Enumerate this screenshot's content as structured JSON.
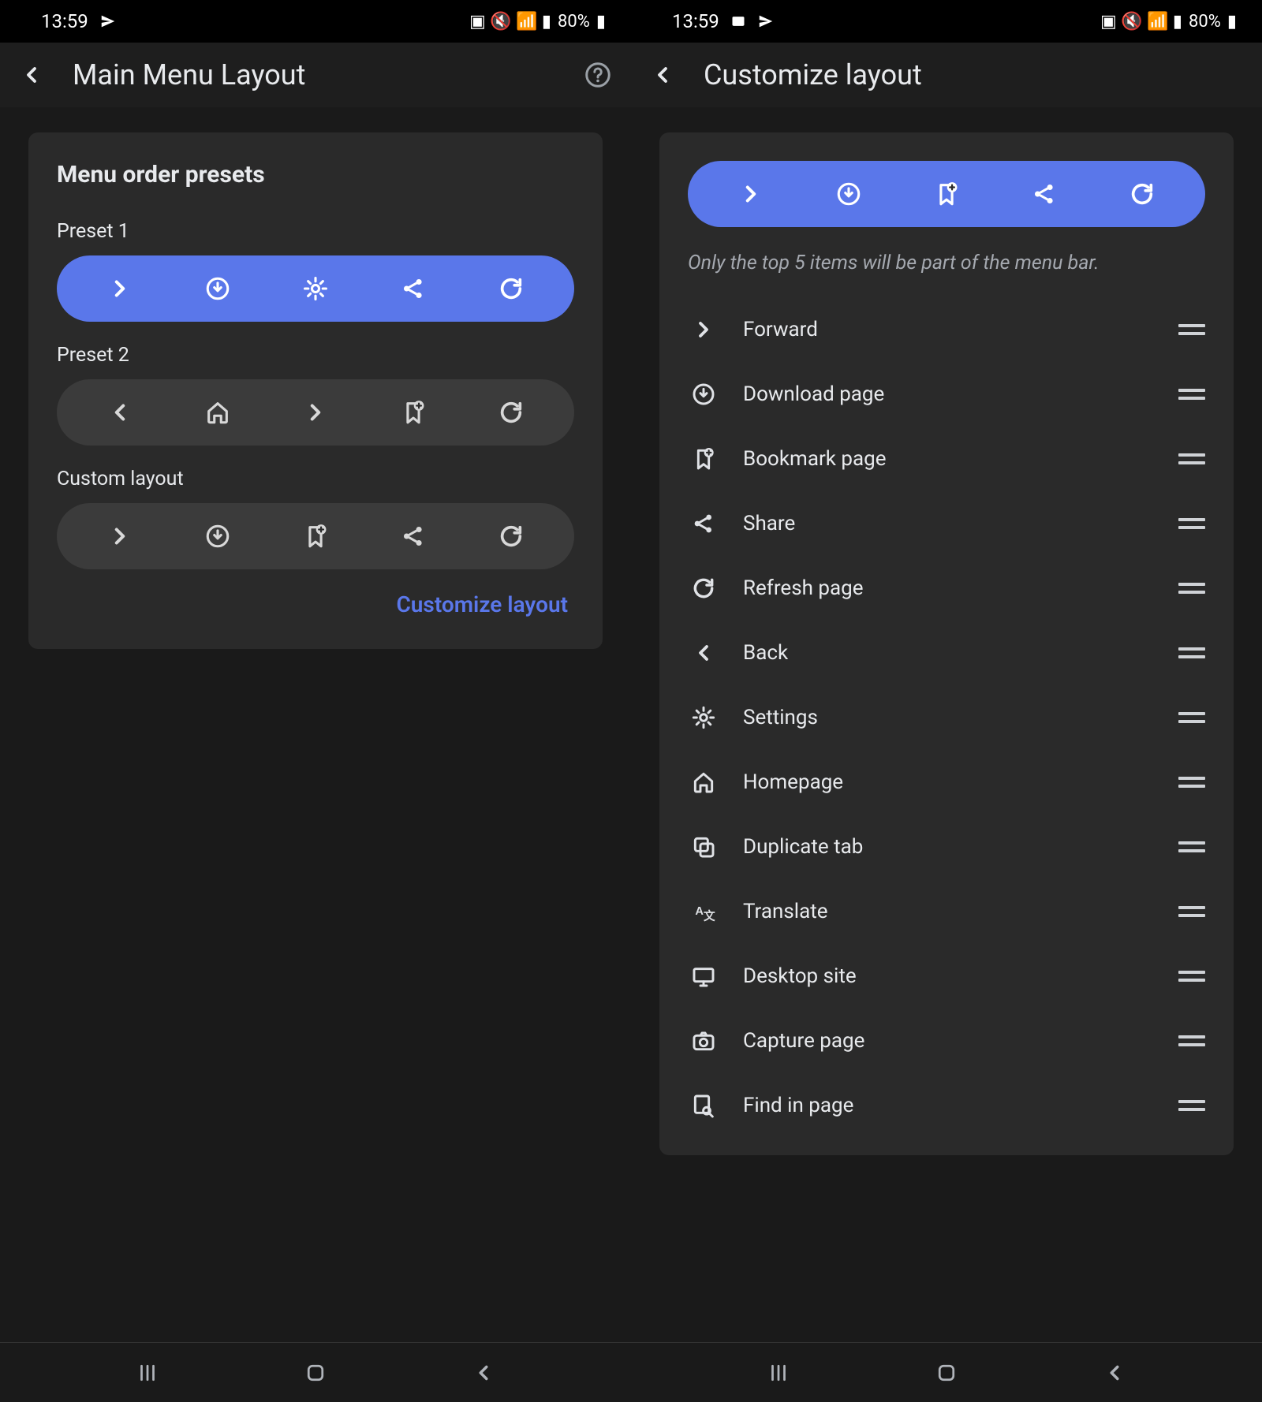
{
  "status": {
    "time": "13:59",
    "battery": "80%"
  },
  "left": {
    "title": "Main Menu Layout",
    "section": "Menu order presets",
    "presets": [
      {
        "label": "Preset 1",
        "style": "blue",
        "icons": [
          "chevron-right",
          "download-circle",
          "gear",
          "share",
          "refresh"
        ]
      },
      {
        "label": "Preset 2",
        "style": "grey",
        "icons": [
          "chevron-left",
          "home",
          "chevron-right",
          "bookmark-add",
          "refresh"
        ]
      },
      {
        "label": "Custom layout",
        "style": "grey",
        "icons": [
          "chevron-right",
          "download-circle",
          "bookmark-add",
          "share",
          "refresh"
        ]
      }
    ],
    "customize": "Customize layout"
  },
  "right": {
    "title": "Customize layout",
    "top_icons": [
      "chevron-right",
      "download-circle",
      "bookmark-add",
      "share",
      "refresh"
    ],
    "note": "Only the top 5 items will be part of the menu bar.",
    "items": [
      {
        "icon": "chevron-right",
        "label": "Forward"
      },
      {
        "icon": "download-circle",
        "label": "Download page"
      },
      {
        "icon": "bookmark-add",
        "label": "Bookmark page"
      },
      {
        "icon": "share",
        "label": "Share"
      },
      {
        "icon": "refresh",
        "label": "Refresh page"
      },
      {
        "icon": "chevron-left",
        "label": "Back"
      },
      {
        "icon": "gear",
        "label": "Settings"
      },
      {
        "icon": "home",
        "label": "Homepage"
      },
      {
        "icon": "duplicate",
        "label": "Duplicate tab"
      },
      {
        "icon": "translate",
        "label": "Translate"
      },
      {
        "icon": "desktop",
        "label": "Desktop site"
      },
      {
        "icon": "camera",
        "label": "Capture page"
      },
      {
        "icon": "find",
        "label": "Find in page"
      }
    ]
  }
}
